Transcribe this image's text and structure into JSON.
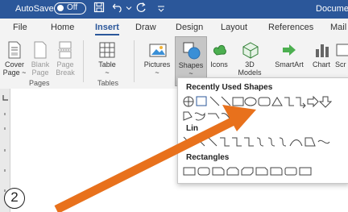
{
  "titlebar": {
    "autosave_label": "AutoSave",
    "autosave_state": "Off",
    "doc_title": "Docume"
  },
  "tabs": [
    "File",
    "Home",
    "Insert",
    "Draw",
    "Design",
    "Layout",
    "References",
    "Mail"
  ],
  "ribbon": {
    "pages": {
      "cover_page": "Cover Page ~",
      "blank_page": "Blank Page",
      "page_break": "Page Break",
      "group_label": "Pages"
    },
    "tables": {
      "table": "Table",
      "table_arrow": "~",
      "group_label": "Tables"
    },
    "illustrations": {
      "pictures": "Pictures",
      "pictures_arrow": "~",
      "shapes": "Shapes",
      "shapes_arrow": "~",
      "icons": "Icons",
      "models": "3D",
      "models_line2": "Models ~",
      "smartart": "SmartArt",
      "chart": "Chart",
      "screenshot": "Scr"
    }
  },
  "shapes_panel": {
    "recent_header": "Recently Used Shapes",
    "lines_header": "Lin",
    "rectangles_header": "Rectangles"
  },
  "annotation": {
    "step_number": "2",
    "arrow_color": "#e8711c"
  },
  "colors": {
    "title_bar": "#2b579a",
    "ribbon_bg": "#f3f3f3"
  }
}
